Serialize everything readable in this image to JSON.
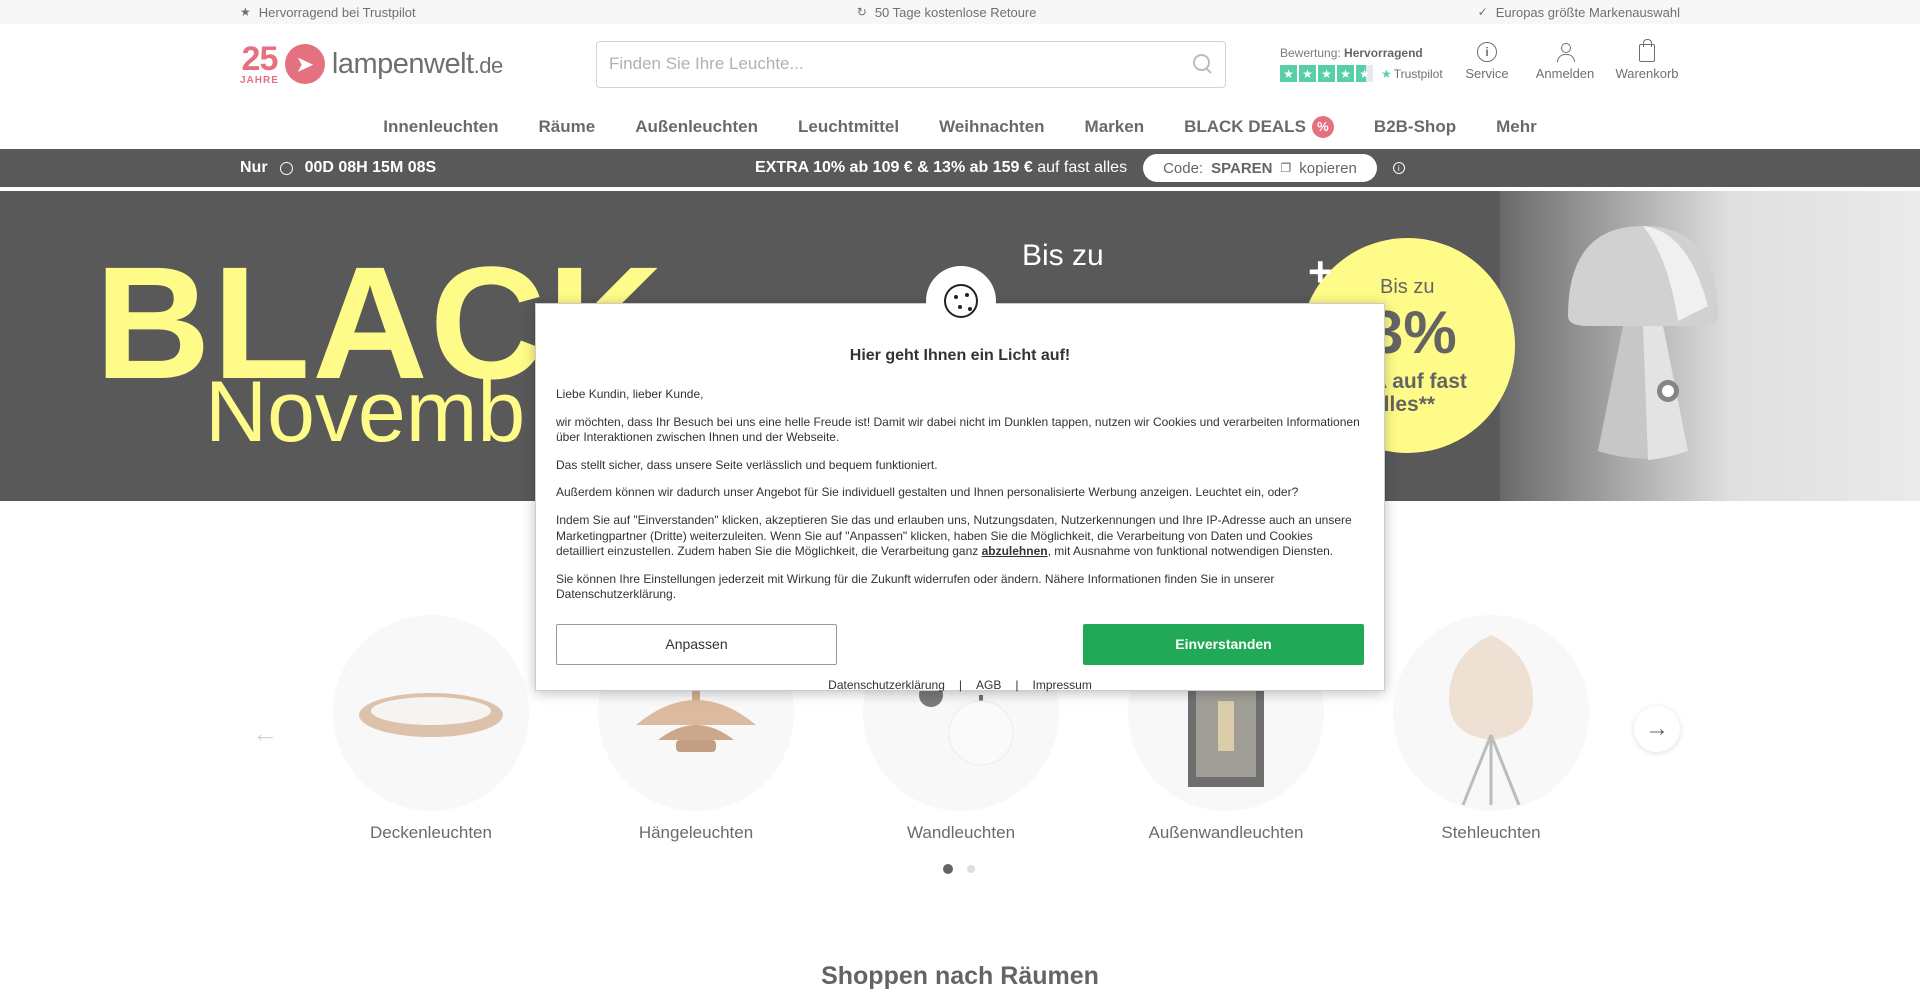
{
  "topbar": {
    "left": "Hervorragend bei Trustpilot",
    "center": "50 Tage kostenlose Retoure",
    "right": "Europas größte Markenauswahl"
  },
  "logo": {
    "years": "25",
    "years_label": "JAHRE",
    "name": "lampenwelt",
    "tld": ".de"
  },
  "search": {
    "placeholder": "Finden Sie Ihre Leuchte..."
  },
  "trustpilot": {
    "label": "Bewertung:",
    "rating": "Hervorragend",
    "brand": "Trustpilot"
  },
  "header_icons": {
    "service": "Service",
    "login": "Anmelden",
    "cart": "Warenkorb"
  },
  "nav": {
    "items": [
      "Innenleuchten",
      "Räume",
      "Außenleuchten",
      "Leuchtmittel",
      "Weihnachten",
      "Marken",
      "BLACK DEALS",
      "B2B-Shop",
      "Mehr"
    ]
  },
  "promo": {
    "prefix": "Nur",
    "timer": "00D 08H 15M 08S",
    "offer_bold": "EXTRA 10% ab 109 € & 13% ab 159 €",
    "offer_rest": "auf fast alles",
    "code_label": "Code:",
    "code": "SPAREN",
    "copy": "kopieren"
  },
  "hero": {
    "line1": "BLACK",
    "line2": "Novemb",
    "bis": "Bis zu",
    "bis2": "Bis zu",
    "percent_partial": "3%",
    "circle_rest": "A auf fast\nalles**",
    "plus": "+"
  },
  "cookie": {
    "title": "Hier geht Ihnen ein Licht auf!",
    "greeting": "Liebe Kundin, lieber Kunde,",
    "p1": "wir möchten, dass Ihr Besuch bei uns eine helle Freude ist! Damit wir dabei nicht im Dunklen tappen, nutzen wir Cookies und verarbeiten Informationen über Interaktionen zwischen Ihnen und der Webseite.",
    "p2": "Das stellt sicher, dass unsere Seite verlässlich und bequem funktioniert.",
    "p3": "Außerdem können wir dadurch unser Angebot für Sie individuell gestalten und Ihnen personalisierte Werbung anzeigen. Leuchtet ein, oder?",
    "p4_a": "Indem Sie auf \"Einverstanden\" klicken, akzeptieren Sie das und erlauben uns, Nutzungsdaten, Nutzerkennungen und Ihre IP-Adresse auch an unsere Marketingpartner (Dritte) weiterzuleiten. Wenn Sie auf \"Anpassen\" klicken, haben Sie die Möglichkeit, die Verarbeitung von Daten und Cookies detailliert einzustellen. Zudem haben Sie die Möglichkeit, die Verarbeitung ganz ",
    "p4_link": "abzulehnen",
    "p4_b": ", mit Ausnahme von funktional notwendigen Diensten.",
    "p5": "Sie können Ihre Einstellungen jederzeit mit Wirkung für die Zukunft widerrufen oder ändern. Nähere Informationen finden Sie in unserer Datenschutzerklärung.",
    "btn_customize": "Anpassen",
    "btn_accept": "Einverstanden",
    "link_privacy": "Datenschutzerklärung",
    "link_agb": "AGB",
    "link_imprint": "Impressum",
    "divider": "|"
  },
  "categories": [
    "Deckenleuchten",
    "Hängeleuchten",
    "Wandleuchten",
    "Außenwandleuchten",
    "Stehleuchten"
  ],
  "section_title": "Shoppen nach Räumen",
  "colors": {
    "brand_red": "#d6263d",
    "trustpilot_green": "#00b67a",
    "accept_green": "#21a957",
    "hero_yellow": "#fff94a"
  },
  "icons": [
    "star-icon",
    "return-icon",
    "check-icon",
    "search-icon",
    "info-icon",
    "user-icon",
    "bag-icon",
    "stopwatch-icon",
    "copy-icon",
    "cookie-icon",
    "arrow-left-icon",
    "arrow-right-icon"
  ]
}
